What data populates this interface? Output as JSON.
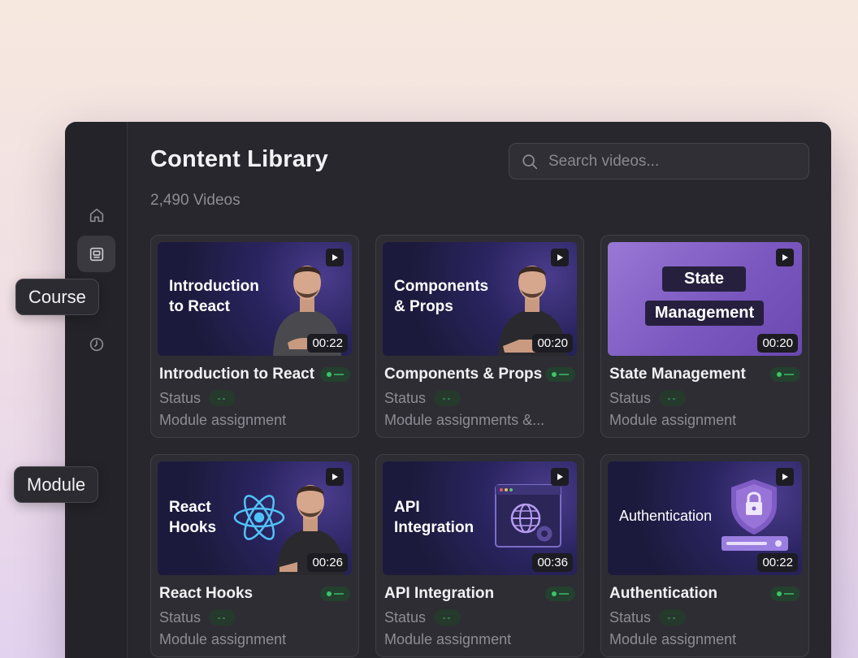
{
  "header": {
    "title": "Content Library",
    "count": "2,490 Videos",
    "search_placeholder": "Search videos..."
  },
  "sidebar": {
    "items": [
      {
        "name": "home",
        "icon": "home-icon"
      },
      {
        "name": "course",
        "icon": "course-icon",
        "active": true
      },
      {
        "name": "module",
        "icon": "clock-icon"
      }
    ]
  },
  "tooltips": {
    "course": "Course",
    "module": "Module"
  },
  "cards": [
    {
      "thumb_lines": [
        "Introduction",
        "to React"
      ],
      "duration": "00:22",
      "title": "Introduction to React",
      "status_label": "Status",
      "status_value": "--",
      "module": "Module assignment"
    },
    {
      "thumb_lines": [
        "Components",
        "& Props"
      ],
      "duration": "00:20",
      "title": "Components & Props",
      "status_label": "Status",
      "status_value": "--",
      "module": "Module assignments &..."
    },
    {
      "thumb_lines": [
        "State",
        "Management"
      ],
      "duration": "00:20",
      "title": "State Management",
      "status_label": "Status",
      "status_value": "--",
      "module": "Module assignment"
    },
    {
      "thumb_lines": [
        "React",
        "Hooks"
      ],
      "duration": "00:26",
      "title": "React Hooks",
      "status_label": "Status",
      "status_value": "--",
      "module": "Module assignment"
    },
    {
      "thumb_lines": [
        "API",
        "Integration"
      ],
      "duration": "00:36",
      "title": "API Integration",
      "status_label": "Status",
      "status_value": "--",
      "module": "Module assignment"
    },
    {
      "thumb_lines": [
        "Authentication"
      ],
      "duration": "00:22",
      "title": "Authentication",
      "status_label": "Status",
      "status_value": "--",
      "module": "Module assignment"
    }
  ],
  "colors": {
    "panel": "#28272d",
    "card": "#2e2d33",
    "accent_green": "#3cc46a",
    "thumb_purple": "#8a68cc"
  }
}
